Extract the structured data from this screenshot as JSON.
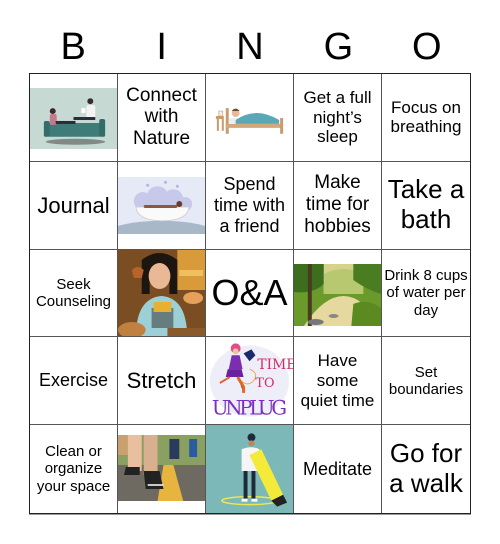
{
  "title_letters": [
    "B",
    "I",
    "N",
    "G",
    "O"
  ],
  "cells": [
    {
      "type": "image",
      "icon": "couch-reading-couple-image"
    },
    {
      "type": "text",
      "text": "Connect with Nature"
    },
    {
      "type": "image",
      "icon": "person-sleeping-in-bed-image"
    },
    {
      "type": "text",
      "text": "Get a full night’s sleep"
    },
    {
      "type": "text",
      "text": "Focus on breathing"
    },
    {
      "type": "text",
      "text": "Journal"
    },
    {
      "type": "image",
      "icon": "person-in-bathtub-image"
    },
    {
      "type": "text",
      "text": "Spend time with a friend"
    },
    {
      "type": "text",
      "text": "Make time for hobbies"
    },
    {
      "type": "text",
      "text": "Take a bath"
    },
    {
      "type": "text",
      "text": "Seek Counseling"
    },
    {
      "type": "image",
      "icon": "woman-eating-food-photo"
    },
    {
      "type": "text",
      "text": "O&A"
    },
    {
      "type": "image",
      "icon": "forest-river-landscape-image"
    },
    {
      "type": "text",
      "text": "Drink 8 cups of water per day"
    },
    {
      "type": "text",
      "text": "Exercise"
    },
    {
      "type": "text",
      "text": "Stretch"
    },
    {
      "type": "image",
      "icon": "time-to-unplug-image",
      "caption_top": "TIME",
      "caption_mid": "TO",
      "caption_bottom": "UNPLUG"
    },
    {
      "type": "text",
      "text": "Have some quiet time"
    },
    {
      "type": "text",
      "text": "Set boundaries"
    },
    {
      "type": "text",
      "text": "Clean or organize your space"
    },
    {
      "type": "image",
      "icon": "walking-feet-photo"
    },
    {
      "type": "image",
      "icon": "person-with-highlighter-image"
    },
    {
      "type": "text",
      "text": "Meditate"
    },
    {
      "type": "text",
      "text": "Go for a walk"
    }
  ],
  "colors": {
    "couch_bg": "#c5d8d2",
    "couch": "#3f7c7a",
    "bath_bg": "#e6e9f6",
    "unplug_text": "#7b2fc0",
    "unplug_pink": "#d0306a",
    "highlighter_bg": "#7bb8b7",
    "highlighter": "#f3ea3a"
  }
}
